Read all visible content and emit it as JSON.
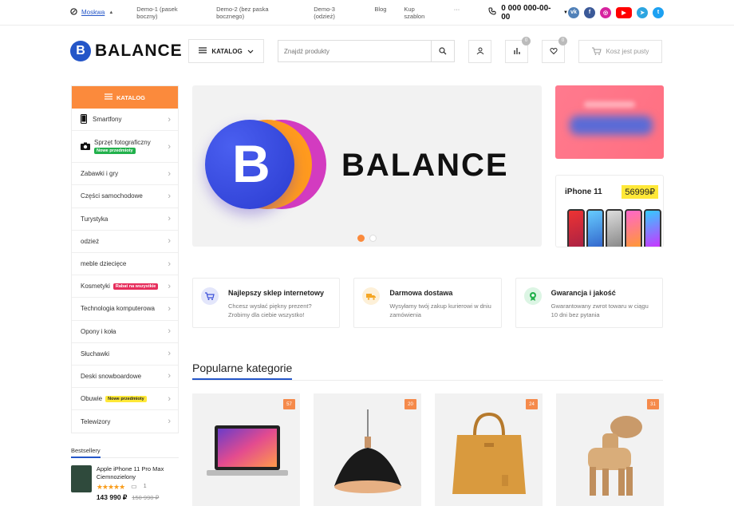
{
  "topbar": {
    "city": "Moskwa",
    "nav": [
      "Demo-1 (pasek boczny)",
      "Demo-2 (bez paska bocznego)",
      "Demo-3 (odzież)",
      "Blog",
      "Kup szablon",
      "···"
    ],
    "phone": "0 000 000-00-00"
  },
  "header": {
    "logo_letter": "B",
    "logo_text": "BALANCE",
    "katalog_label": "KATALOG",
    "search_placeholder": "Znajdź produkty",
    "compare_count": "0",
    "wishlist_count": "0",
    "cart_label": "Kosz jest pusty"
  },
  "sidebar": {
    "title": "KATALOG",
    "items": [
      {
        "label": "Smartfony",
        "tag": ""
      },
      {
        "label": "Sprzęt fotograficzny",
        "tag": "Nowe przedmioty"
      },
      {
        "label": "Zabawki i gry",
        "tag": ""
      },
      {
        "label": "Części samochodowe",
        "tag": ""
      },
      {
        "label": "Turystyka",
        "tag": ""
      },
      {
        "label": "odzież",
        "tag": ""
      },
      {
        "label": "meble dziecięce",
        "tag": ""
      },
      {
        "label": "Kosmetyki",
        "tag": "Rabat na wszystkie"
      },
      {
        "label": "Technologia komputerowa",
        "tag": ""
      },
      {
        "label": "Opony i koła",
        "tag": ""
      },
      {
        "label": "Słuchawki",
        "tag": ""
      },
      {
        "label": "Deski snowboardowe",
        "tag": ""
      },
      {
        "label": "Obuwie",
        "tag": "Nowe przedmioty"
      },
      {
        "label": "Telewizory",
        "tag": ""
      }
    ]
  },
  "bestsellers": {
    "title": "Bestsellery",
    "item": {
      "name": "Apple iPhone 11 Pro Max Ciemnozielony",
      "stars": "★★★★★",
      "reviews": "1",
      "price": "143 990 ₽",
      "old_price": "150 990 ₽"
    }
  },
  "hero": {
    "brand": "BALANCE",
    "logo_letter": "B"
  },
  "promo": {
    "product": "iPhone 11",
    "price": "56999₽"
  },
  "features": [
    {
      "title": "Najlepszy sklep internetowy",
      "desc": "Chcesz wysłać piękny prezent? Zrobimy dla ciebie wszystko!"
    },
    {
      "title": "Darmowa dostawa",
      "desc": "Wysyłamy twój zakup kurierowi w dniu zamówienia"
    },
    {
      "title": "Gwarancja i jakość",
      "desc": "Gwarantowany zwrot towaru w ciągu 10 dni bez pytania"
    }
  ],
  "popular": {
    "title": "Popularne kategorie",
    "counts": [
      "57",
      "20",
      "24",
      "31"
    ]
  },
  "colors": {
    "accent": "#fb8a3c",
    "brand": "#2456c8"
  }
}
